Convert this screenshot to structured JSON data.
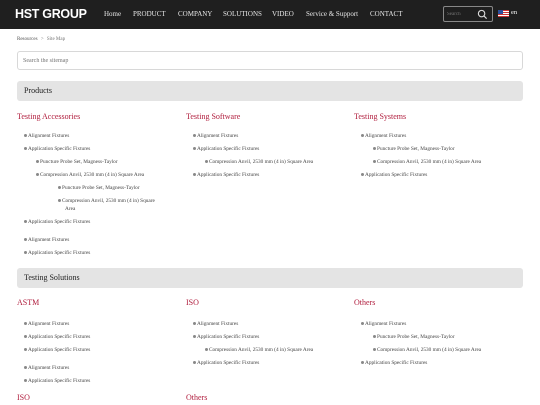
{
  "header": {
    "logo": "HST GROUP",
    "nav": [
      "Home",
      "PRODUCT",
      "COMPANY",
      "SOLUTIONS",
      "VIDEO",
      "Service & Support",
      "CONTACT"
    ],
    "search_placeholder": "Search",
    "lang": "en"
  },
  "breadcrumb": {
    "home": "Resources",
    "sep": ">",
    "current": "Site Map"
  },
  "sitemap_search": {
    "placeholder": "Search the sitemap"
  },
  "sections": [
    {
      "title": "Products",
      "columns": [
        {
          "heading": "Testing Accessories",
          "items": [
            "Alignment Fixtures",
            "Application Specific Fixtures",
            "Puncture Probe Set, Magness-Taylor",
            "Compression Anvil, 2530 mm (4 in) Square Area",
            "Puncture Probe Set, Magness-Taylor",
            "Compression Anvil, 2530 mm (4 in) Square",
            "Area",
            "Application Specific Fixtures",
            "Alignment Fixtures",
            "Application Specific Fixtures"
          ]
        },
        {
          "heading": "Testing Software",
          "items": [
            "Alignment Fixtures",
            "Application Specific Fixtures",
            "Compression Anvil, 2530 mm (4 in) Square Area",
            "Application Specific Fixtures"
          ]
        },
        {
          "heading": "Testing Systems",
          "items": [
            "Alignment Fixtures",
            "Puncture Probe Set, Magness-Taylor",
            "Compression Anvil, 2530 mm (4 in) Square Area",
            "Application Specific Fixtures"
          ]
        }
      ]
    },
    {
      "title": "Testing Solutions",
      "columns": [
        {
          "heading": "ASTM",
          "items": [
            "Alignment Fixtures",
            "Application Specific Fixtures",
            "Application Specific Fixtures",
            "Alignment Fixtures",
            "Application Specific Fixtures"
          ]
        },
        {
          "heading": "ISO",
          "items": [
            "Alignment Fixtures",
            "Application Specific Fixtures",
            "Compression Anvil, 2530 mm (4 in) Square Area",
            "Application Specific Fixtures"
          ]
        },
        {
          "heading": "Others",
          "items": [
            "Alignment Fixtures",
            "Puncture Probe Set, Magness-Taylor",
            "Compression Anvil, 2530 mm (4 in) Square Area",
            "Application Specific Fixtures"
          ]
        }
      ]
    }
  ],
  "bottom_headings": [
    "ISO",
    "Others"
  ]
}
